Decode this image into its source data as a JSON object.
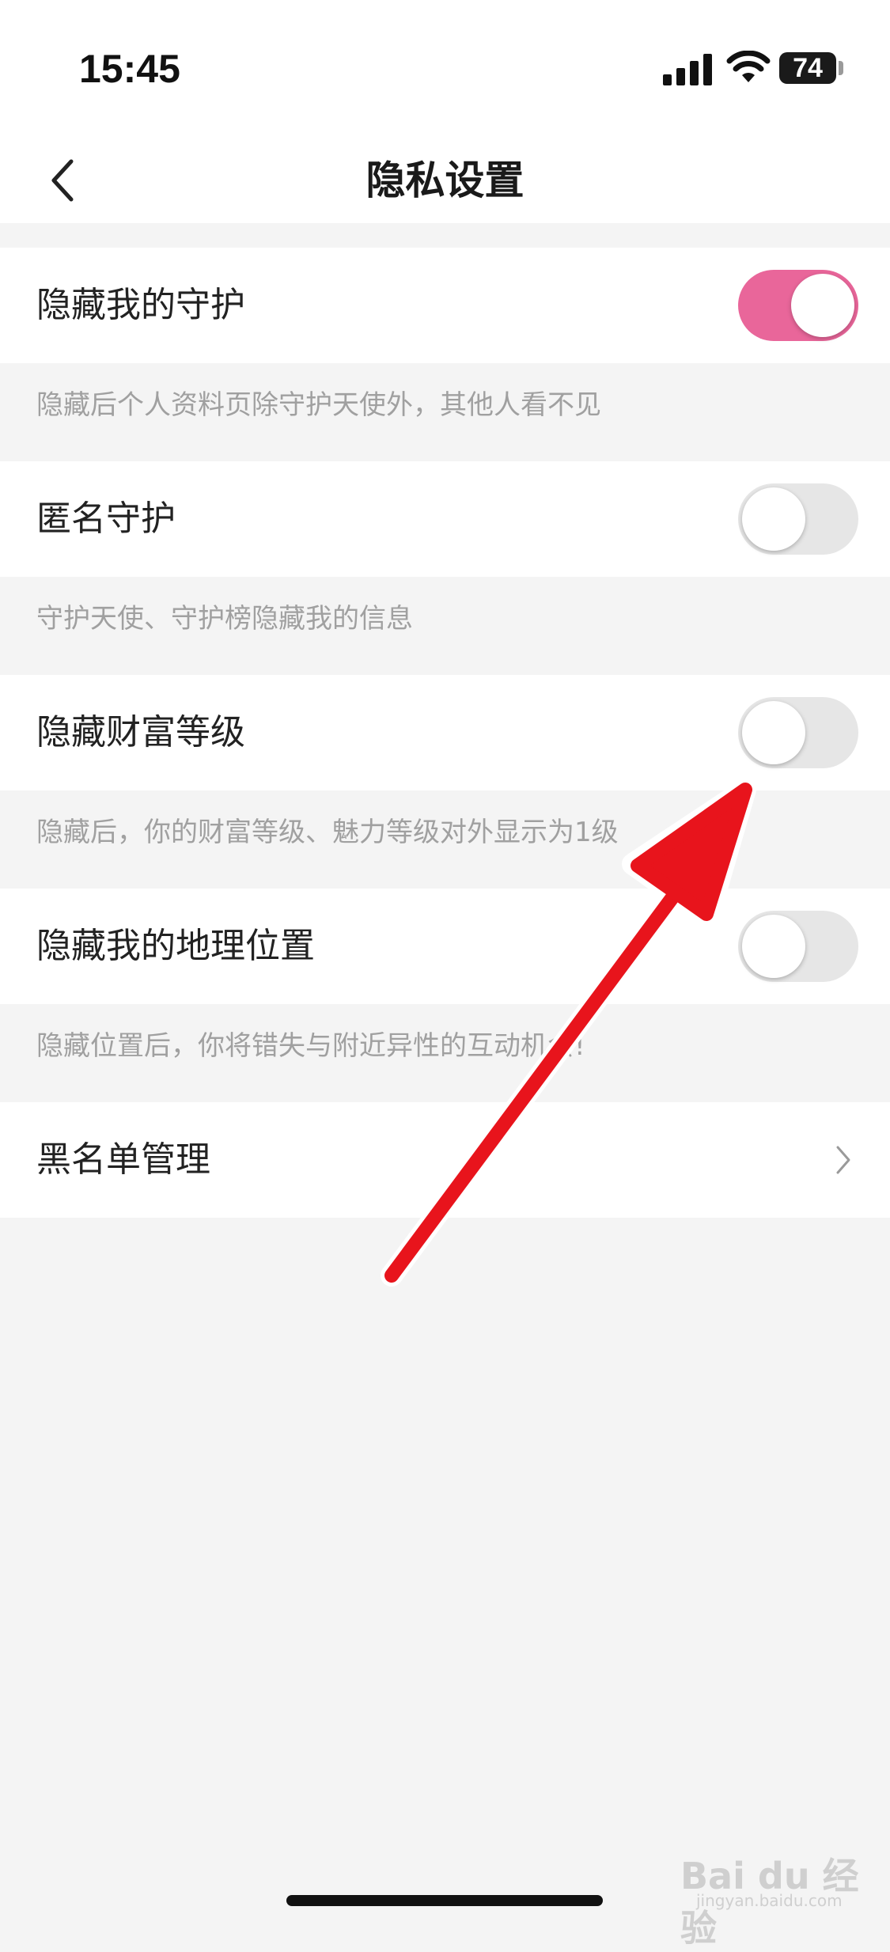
{
  "status_bar": {
    "time": "15:45",
    "battery": "74",
    "icons": [
      "signal-icon",
      "wifi-icon",
      "battery-icon"
    ]
  },
  "header": {
    "title": "隐私设置",
    "back_icon": "chevron-left-icon"
  },
  "settings": [
    {
      "label": "隐藏我的守护",
      "enabled": true,
      "description": "隐藏后个人资料页除守护天使外，其他人看不见"
    },
    {
      "label": "匿名守护",
      "enabled": false,
      "description": "守护天使、守护榜隐藏我的信息"
    },
    {
      "label": "隐藏财富等级",
      "enabled": false,
      "description": "隐藏后，你的财富等级、魅力等级对外显示为1级"
    },
    {
      "label": "隐藏我的地理位置",
      "enabled": false,
      "description": "隐藏位置后，你将错失与附近异性的互动机会!"
    }
  ],
  "blacklist": {
    "label": "黑名单管理",
    "icon": "chevron-right-icon"
  },
  "colors": {
    "toggle_on": "#e9669a",
    "toggle_off": "#e6e6e6",
    "annotation_arrow": "#e8141c",
    "background": "#f4f4f4"
  },
  "watermark": {
    "brand": "Bai du 经验",
    "url": "jingyan.baidu.com"
  }
}
